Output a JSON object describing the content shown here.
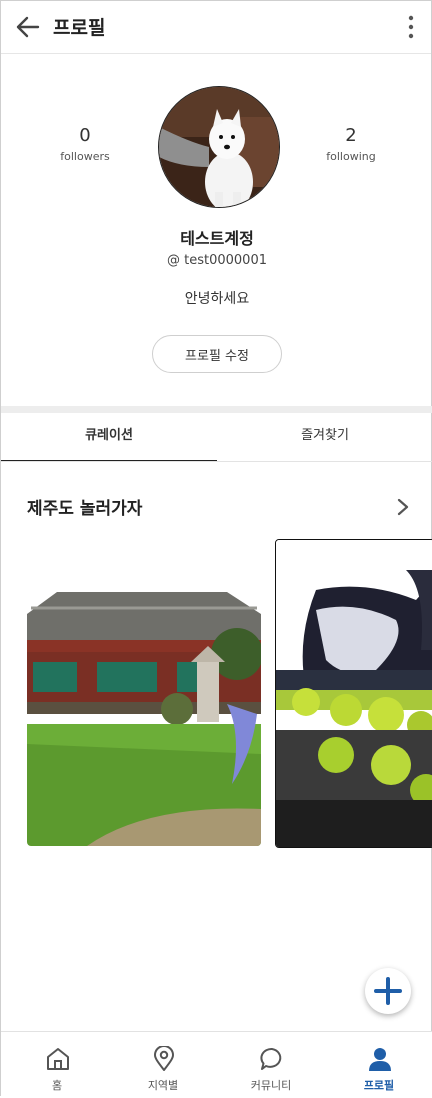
{
  "header": {
    "title": "프로필"
  },
  "profile": {
    "followers_count": "0",
    "followers_label": "followers",
    "following_count": "2",
    "following_label": "following",
    "name": "테스트계정",
    "handle": "@ test0000001",
    "bio": "안녕하세요",
    "edit_label": "프로필 수정"
  },
  "tabs": [
    {
      "label": "큐레이션",
      "active": true
    },
    {
      "label": "즐겨찾기",
      "active": false
    }
  ],
  "section": {
    "title": "제주도 놀러가자"
  },
  "bottom_nav": [
    {
      "label": "홈",
      "icon": "home-icon"
    },
    {
      "label": "지역별",
      "icon": "location-pin-icon"
    },
    {
      "label": "커뮤니티",
      "icon": "chat-bubble-icon"
    },
    {
      "label": "프로필",
      "icon": "person-icon",
      "active": true
    }
  ],
  "colors": {
    "accent": "#1f5ea8"
  }
}
